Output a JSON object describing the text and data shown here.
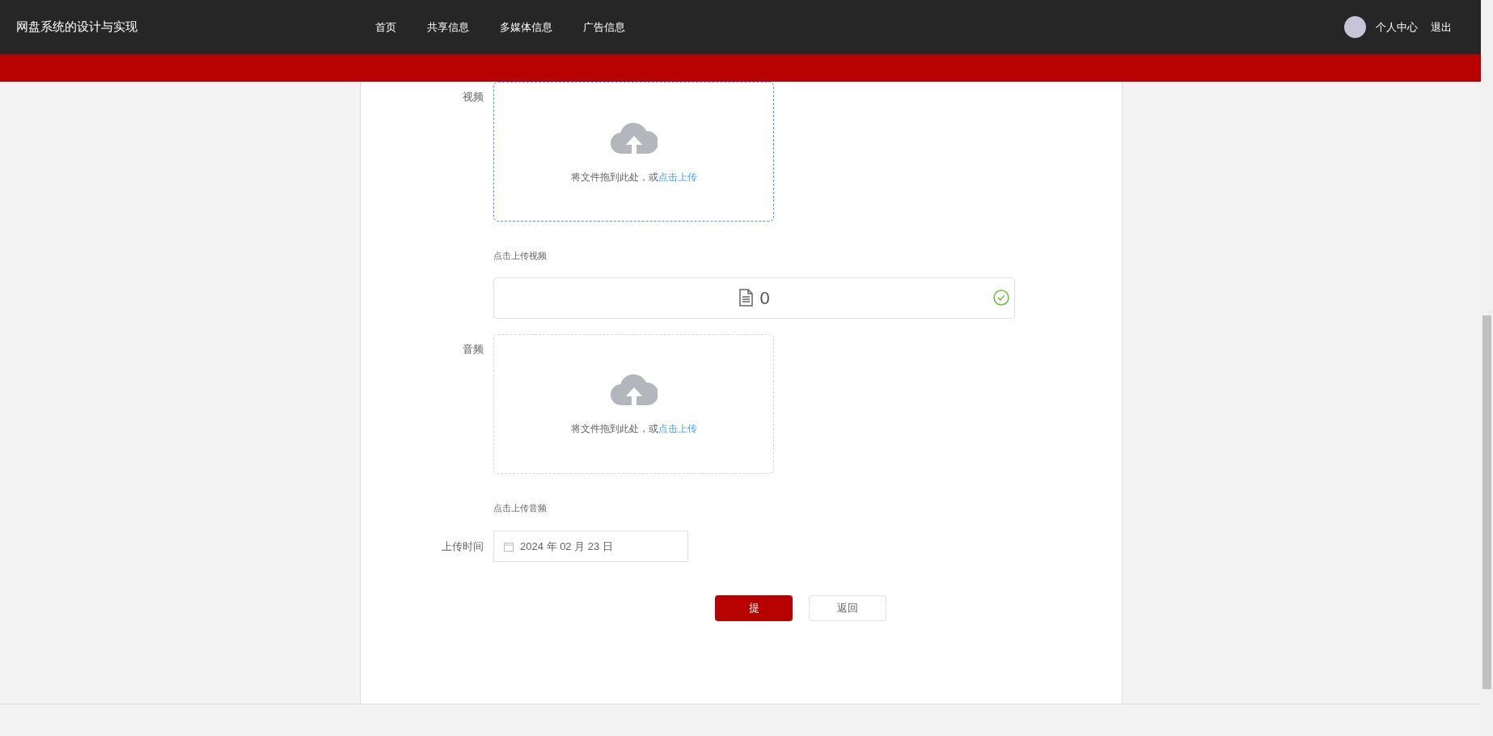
{
  "header": {
    "title": "网盘系统的设计与实现",
    "nav": [
      {
        "label": "首页"
      },
      {
        "label": "共享信息"
      },
      {
        "label": "多媒体信息"
      },
      {
        "label": "广告信息"
      }
    ],
    "user_links": [
      "个人中心",
      "退出"
    ]
  },
  "form": {
    "fields": [
      {
        "kind": "upload",
        "label": "视频",
        "active": true,
        "drop_text": "将文件拖到此处，或",
        "link": "点击上传",
        "hint": "点击上传视频",
        "file": {
          "name": "0",
          "success": true
        }
      },
      {
        "kind": "upload",
        "label": "音频",
        "active": false,
        "drop_text": "将文件拖到此处，或",
        "link": "点击上传",
        "hint": "点击上传音频"
      },
      {
        "kind": "date",
        "label": "上传时间",
        "value": "2024 年 02 月 23 日"
      }
    ],
    "buttons": [
      {
        "label": "提",
        "kind": "primary"
      },
      {
        "label": "返回",
        "kind": "default"
      }
    ]
  }
}
